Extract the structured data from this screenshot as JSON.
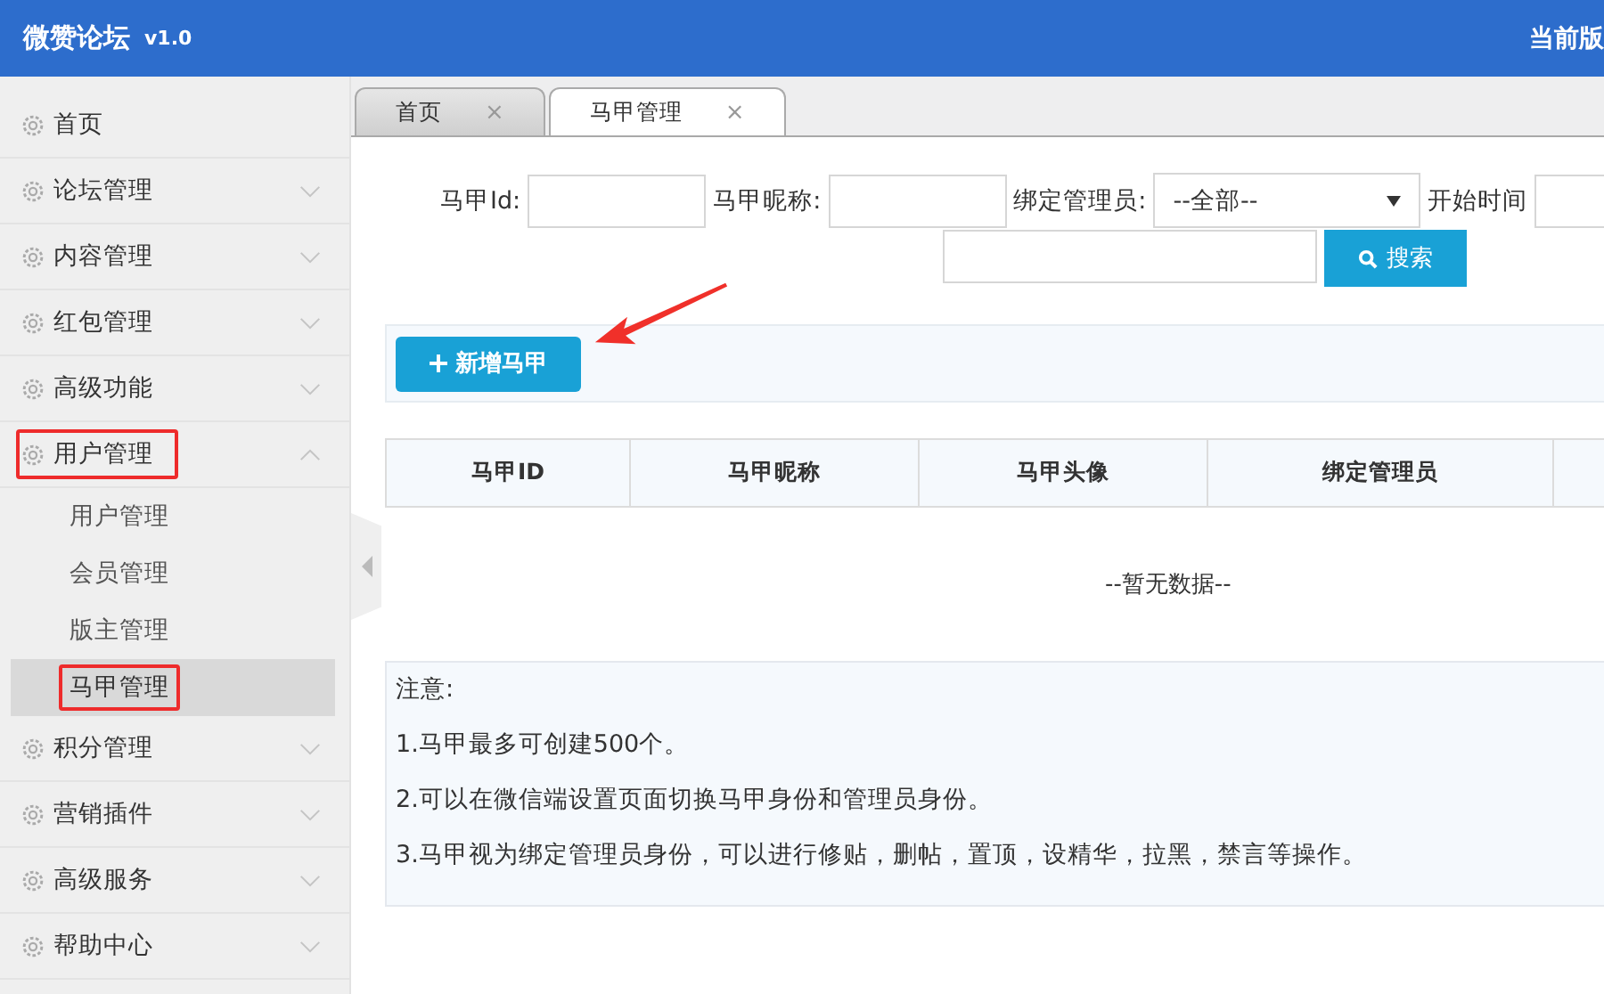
{
  "header": {
    "title": "微赞论坛",
    "version": "v1.0",
    "right_text": "当前版"
  },
  "sidebar": {
    "items": [
      {
        "label": "首页",
        "expandable": false,
        "highlighted": false
      },
      {
        "label": "论坛管理",
        "expandable": true,
        "expanded": false,
        "highlighted": false
      },
      {
        "label": "内容管理",
        "expandable": true,
        "expanded": false,
        "highlighted": false
      },
      {
        "label": "红包管理",
        "expandable": true,
        "expanded": false,
        "highlighted": false
      },
      {
        "label": "高级功能",
        "expandable": true,
        "expanded": false,
        "highlighted": false
      },
      {
        "label": "用户管理",
        "expandable": true,
        "expanded": true,
        "highlighted": true,
        "children": [
          {
            "label": "用户管理",
            "selected": false,
            "highlighted": false
          },
          {
            "label": "会员管理",
            "selected": false,
            "highlighted": false
          },
          {
            "label": "版主管理",
            "selected": false,
            "highlighted": false
          },
          {
            "label": "马甲管理",
            "selected": true,
            "highlighted": true
          }
        ]
      },
      {
        "label": "积分管理",
        "expandable": true,
        "expanded": false,
        "highlighted": false
      },
      {
        "label": "营销插件",
        "expandable": true,
        "expanded": false,
        "highlighted": false
      },
      {
        "label": "高级服务",
        "expandable": true,
        "expanded": false,
        "highlighted": false
      },
      {
        "label": "帮助中心",
        "expandable": true,
        "expanded": false,
        "highlighted": false
      }
    ]
  },
  "tabs": [
    {
      "label": "首页",
      "selected": false,
      "close": "×"
    },
    {
      "label": "马甲管理",
      "selected": true,
      "close": "×"
    }
  ],
  "filters": {
    "id_label": "马甲Id:",
    "nickname_label": "马甲昵称:",
    "admin_label": "绑定管理员:",
    "admin_value": "--全部--",
    "start_label": "开始时间",
    "search_button": "搜索"
  },
  "toolbar": {
    "add_button": "新增马甲"
  },
  "table": {
    "columns": [
      "马甲ID",
      "马甲昵称",
      "马甲头像",
      "绑定管理员"
    ],
    "empty_text": "--暂无数据--"
  },
  "notes": {
    "title": "注意:",
    "lines": [
      "1.马甲最多可创建500个。",
      "2.可以在微信端设置页面切换马甲身份和管理员身份。",
      "3.马甲视为绑定管理员身份，可以进行修贴，删帖，置顶，设精华，拉黑，禁言等操作。"
    ]
  }
}
